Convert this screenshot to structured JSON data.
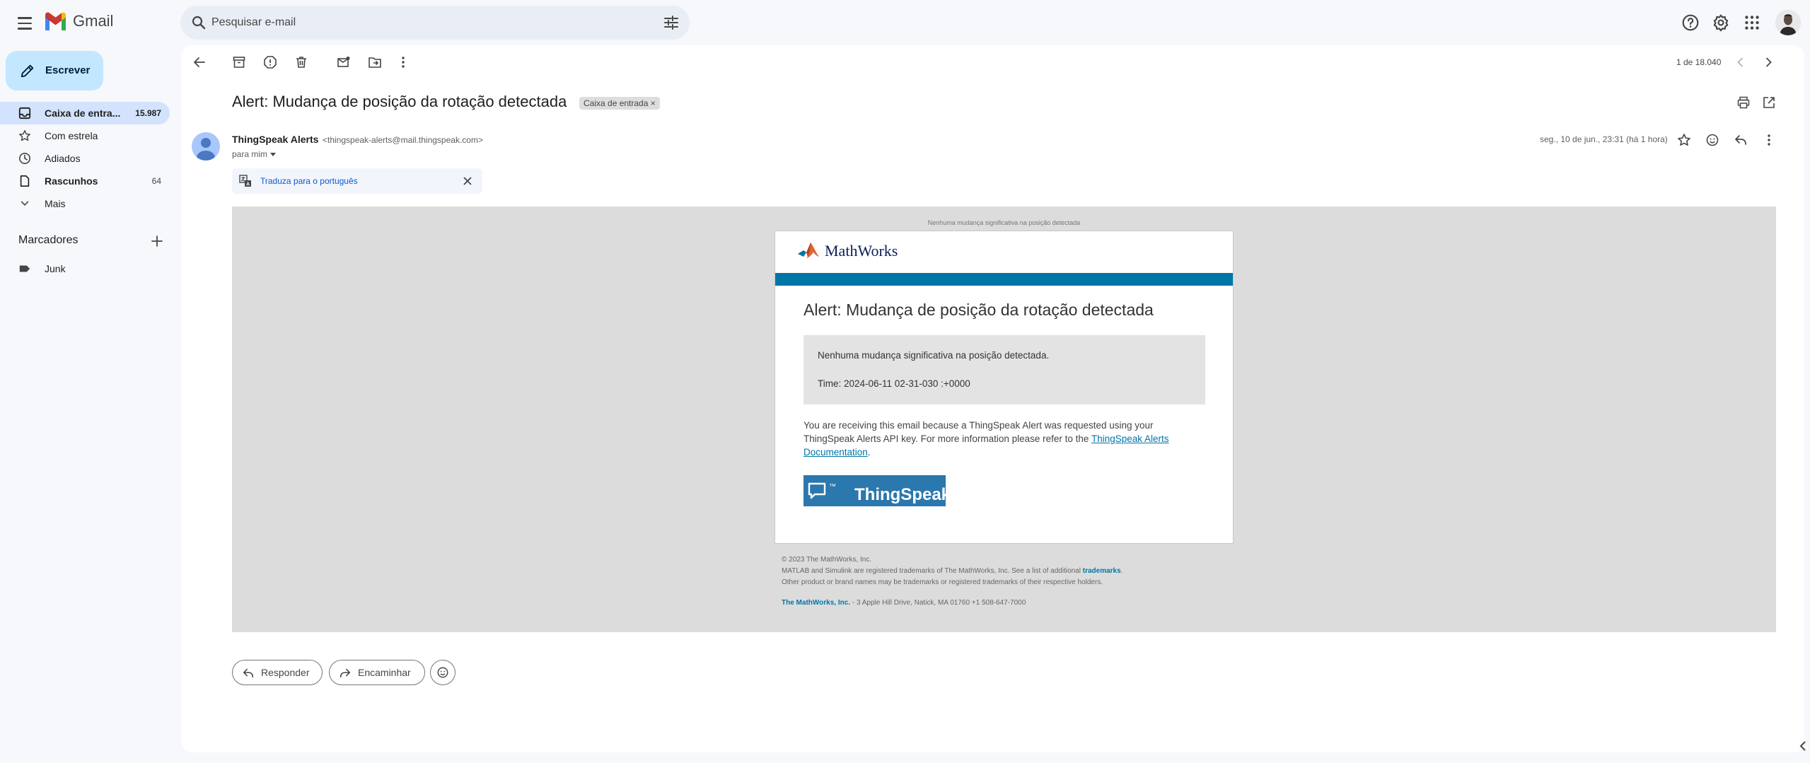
{
  "app": {
    "name": "Gmail"
  },
  "search": {
    "placeholder": "Pesquisar e-mail"
  },
  "icons": {
    "menu": "hamburger-icon",
    "search": "search-icon",
    "tune": "tune-icon",
    "help": "help-icon",
    "settings": "gear-icon",
    "apps": "apps-grid-icon"
  },
  "sidebar": {
    "compose_label": "Escrever",
    "items": [
      {
        "label": "Caixa de entra...",
        "count": "15.987",
        "icon": "inbox-icon",
        "active": true
      },
      {
        "label": "Com estrela",
        "count": "",
        "icon": "star-icon"
      },
      {
        "label": "Adiados",
        "count": "",
        "icon": "clock-icon"
      },
      {
        "label": "Rascunhos",
        "count": "64",
        "icon": "draft-icon"
      },
      {
        "label": "Mais",
        "count": "",
        "icon": "chevron-down-icon"
      }
    ],
    "labels_title": "Marcadores",
    "labels": [
      {
        "label": "Junk",
        "icon": "label-icon"
      }
    ]
  },
  "toolbar": {
    "pager": "1 de 18.040"
  },
  "message": {
    "subject": "Alert: Mudança de posição da rotação detectada",
    "chip": "Caixa de entrada",
    "chip_close": "×",
    "sender_name": "ThingSpeak Alerts",
    "sender_email": "<thingspeak-alerts@mail.thingspeak.com>",
    "to": "para mim",
    "date": "seg., 10 de jun., 23:31 (há 1 hora)",
    "translate": "Traduza para o português"
  },
  "email": {
    "preheader": "Nenhuma mudança significativa na posição detectada",
    "brand": "MathWorks",
    "title": "Alert: Mudança de posição da rotação detectada",
    "box_line1": "Nenhuma mudança significativa na posição detectada.",
    "box_line2": "Time: 2024-06-11 02-31-030 :+0000",
    "info_text": "You are receiving this email because a ThingSpeak Alert was requested using your ThingSpeak Alerts API key. For more information please refer to the ",
    "info_link": "ThingSpeak Alerts Documentation",
    "info_end": ".",
    "ts_logo": "ThingSpeak",
    "ts_tm": "™",
    "footer_copyright": "© 2023 The MathWorks, Inc.",
    "footer_tm_text": "MATLAB and Simulink are registered trademarks of The MathWorks, Inc. See a list of additional ",
    "footer_tm_link": "trademarks",
    "footer_tm_end": ".",
    "footer_other": "Other product or brand names may be trademarks or registered trademarks of their respective holders.",
    "footer_company": "The MathWorks, Inc.",
    "footer_address": " - 3 Apple Hill Drive, Natick, MA 01760 +1 508-647-7000"
  },
  "actions": {
    "reply": "Responder",
    "forward": "Encaminhar"
  },
  "colors": {
    "compose_bg": "#c2e7ff",
    "active_nav": "#d3e3fd",
    "mathworks_blue": "#0076a8",
    "link": "#0b57d0"
  }
}
